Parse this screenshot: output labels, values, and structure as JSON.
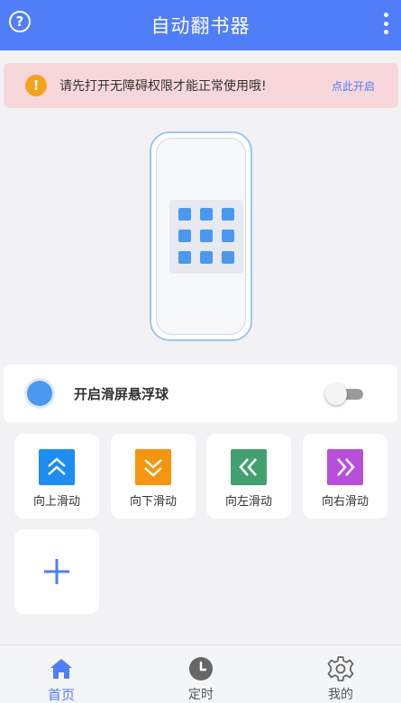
{
  "header": {
    "title": "自动翻书器",
    "help_glyph": "?",
    "color": "#4f7ef8"
  },
  "notice": {
    "warn_glyph": "!",
    "message": "请先打开无障碍权限才能正常使用哦!",
    "link_label": "点此开启"
  },
  "float_ball": {
    "label": "开启滑屏悬浮球",
    "enabled": false
  },
  "actions": [
    {
      "label": "向上滑动",
      "icon": "double-chevron-up-icon",
      "color": "#1e8cf0"
    },
    {
      "label": "向下滑动",
      "icon": "double-chevron-down-icon",
      "color": "#f5950f"
    },
    {
      "label": "向左滑动",
      "icon": "double-chevron-left-icon",
      "color": "#43a071"
    },
    {
      "label": "向右滑动",
      "icon": "double-chevron-right-icon",
      "color": "#b84fdb"
    }
  ],
  "add_button": {
    "icon": "plus-icon",
    "color": "#4f7ef8"
  },
  "bottom_nav": [
    {
      "label": "首页",
      "icon": "home-icon",
      "active": true
    },
    {
      "label": "定时",
      "icon": "clock-icon",
      "active": false
    },
    {
      "label": "我的",
      "icon": "gear-icon",
      "active": false
    }
  ]
}
